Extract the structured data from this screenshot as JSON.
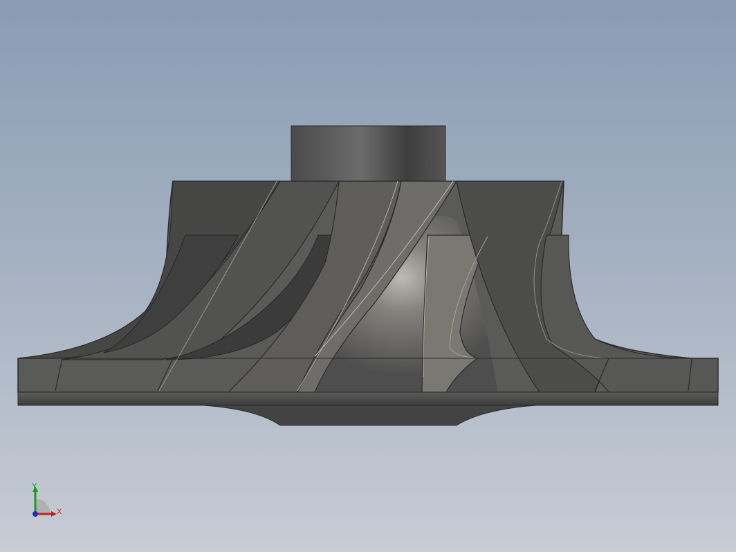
{
  "viewport": {
    "background_top": "#8a9bb3",
    "background_bottom": "#c7ccd5",
    "model": "impeller"
  },
  "triad": {
    "x_label": "X",
    "y_label": "Y",
    "x_color": "#d22020",
    "y_color": "#1a9a1a",
    "z_color": "#1a2fc0"
  }
}
